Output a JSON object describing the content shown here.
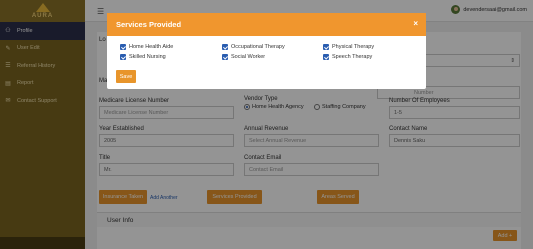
{
  "app": {
    "logo_text": "AURA"
  },
  "sidebar": {
    "items": [
      {
        "label": "Profile",
        "icon": "user-icon",
        "glyph": "⚇",
        "active": true
      },
      {
        "label": "User Edit",
        "icon": "edit-icon",
        "glyph": "✎",
        "active": false
      },
      {
        "label": "Referral History",
        "icon": "history-icon",
        "glyph": "☰",
        "active": false
      },
      {
        "label": "Report",
        "icon": "chart-icon",
        "glyph": "▤",
        "active": false
      },
      {
        "label": "Contact Support",
        "icon": "chat-icon",
        "glyph": "✉",
        "active": false
      }
    ]
  },
  "topbar": {
    "user_email": "devendersaai@gmail.com"
  },
  "form": {
    "partial_labels": {
      "left_top": "Lo",
      "left_mid": "Ma",
      "right_mid": "umber"
    },
    "medicare_label": "Medicare License Number",
    "medicare_placeholder": "Medicare License Number",
    "vendor_type_label": "Vendor Type",
    "vendor_options": [
      {
        "label": "Home Health Agency",
        "selected": true
      },
      {
        "label": "Staffing Company",
        "selected": false
      }
    ],
    "employees_label": "Number Of Employees",
    "employees_value": "1-5",
    "year_label": "Year Established",
    "year_value": "2005",
    "revenue_label": "Annual Revenue",
    "revenue_placeholder": "Select Annual Revenue",
    "contact_name_label": "Contact Name",
    "contact_name_value": "Dennis Saku",
    "title_label": "Title",
    "title_value": "Mr.",
    "contact_email_label": "Contact Email",
    "contact_email_placeholder": "Contact Email",
    "right_top_placeholder": "Number"
  },
  "buttons": {
    "insurance": "Insurance Taken",
    "add_another": "Add Another",
    "services": "Services Provided",
    "areas": "Areas Served",
    "add": "Add +"
  },
  "user_info": {
    "title": "User Info"
  },
  "modal": {
    "title": "Services Provided",
    "close_glyph": "×",
    "save_label": "Save",
    "services": [
      {
        "label": "Home Health Aide",
        "checked": true
      },
      {
        "label": "Occupational Therapy",
        "checked": true
      },
      {
        "label": "Physical Therapy",
        "checked": true
      },
      {
        "label": "Skilled Nursing",
        "checked": true
      },
      {
        "label": "Social Worker",
        "checked": true
      },
      {
        "label": "Speech Therapy",
        "checked": true
      }
    ]
  },
  "colors": {
    "accent": "#e8952b",
    "sidebar": "#7a6420",
    "active_nav": "#2b2f4a",
    "checkbox": "#2a5db0"
  }
}
